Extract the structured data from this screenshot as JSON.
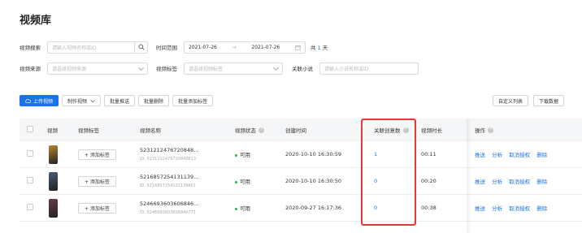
{
  "page": {
    "title": "视频库"
  },
  "filters": {
    "video_search": {
      "label": "视频搜索",
      "placeholder": "请输入视频名称或ID"
    },
    "time_range": {
      "label": "时间范围",
      "start": "2021-07-26",
      "separator": "→",
      "end": "2021-07-26",
      "total_prefix": "共",
      "total_days": "1",
      "total_suffix": "天"
    },
    "video_source": {
      "label": "视频来源",
      "placeholder": "请选择视频来源"
    },
    "video_tag": {
      "label": "视频标签",
      "placeholder": "请选择视频标签"
    },
    "linked_novel": {
      "label": "关联小说",
      "placeholder": "请输入小说名称或ID"
    }
  },
  "toolbar": {
    "upload": "上传视频",
    "make": "制作视频",
    "batch_push": "批量推送",
    "batch_delete": "批量删除",
    "batch_add_tag": "批量添加标签",
    "custom_columns": "自定义列表",
    "download": "下载数据"
  },
  "table": {
    "headers": {
      "video": "视频",
      "tag": "视频标签",
      "name": "视频名称",
      "status": "视频状态",
      "created": "创建时间",
      "creatives": "关联创意数",
      "duration": "视频时长",
      "ops": "操作"
    },
    "rows": [
      {
        "tag_btn": "+ 添加标签",
        "name": "5231212476720848...",
        "id": "ID: 5231212476720848813",
        "status": "可用",
        "created": "2020-10-10 16:30:59",
        "creatives": "1",
        "duration": "00:11",
        "thumb_color": "#b8862f"
      },
      {
        "tag_btn": "+ 添加标签",
        "name": "5216857254131139...",
        "id": "ID: 5216857254131139861",
        "status": "可用",
        "created": "2020-10-10 16:30:50",
        "creatives": "0",
        "duration": "00:20",
        "thumb_color": "#4a5a7a"
      },
      {
        "tag_btn": "+ 添加标签",
        "name": "5246693603606846...",
        "id": "ID: 5246693603606846771",
        "status": "可用",
        "created": "2020-09-27 16:17:36",
        "creatives": "0",
        "duration": "00:38",
        "thumb_color": "#6b3a4a"
      }
    ],
    "actions": {
      "push": "推送",
      "analyze": "分析",
      "revoke": "取消授权",
      "delete": "删除"
    }
  },
  "colors": {
    "accent": "#1a73e8",
    "status_ok": "#22b14c",
    "highlight": "#e53935"
  }
}
